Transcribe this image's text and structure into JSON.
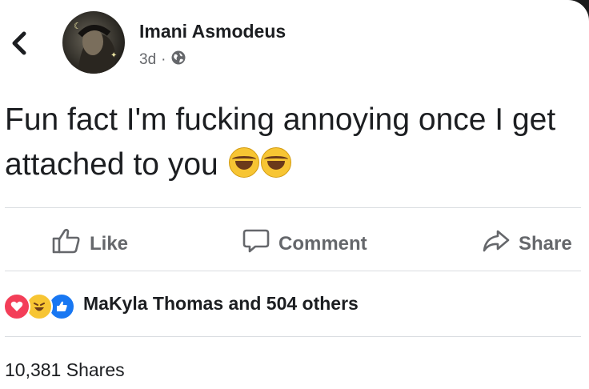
{
  "post": {
    "author": "Imani Asmodeus",
    "time": "3d",
    "separator": "·",
    "privacy_icon": "globe-icon",
    "text": "Fun fact I'm fucking annoying once I get attached to you",
    "emojis": [
      "tears-of-joy-emoji",
      "tears-of-joy-emoji"
    ]
  },
  "actions": {
    "like": "Like",
    "comment": "Comment",
    "share": "Share"
  },
  "reactions": {
    "icons": [
      "love-reaction",
      "haha-reaction",
      "like-reaction"
    ],
    "summary": "MaKyla Thomas and 504 others"
  },
  "shares": "10,381 Shares",
  "colors": {
    "text": "#1c1e21",
    "secondary": "#65676b",
    "like_blue": "#1877f2",
    "love_red": "#f33e58",
    "haha_yellow": "#f7c533",
    "divider": "#dadde1"
  }
}
